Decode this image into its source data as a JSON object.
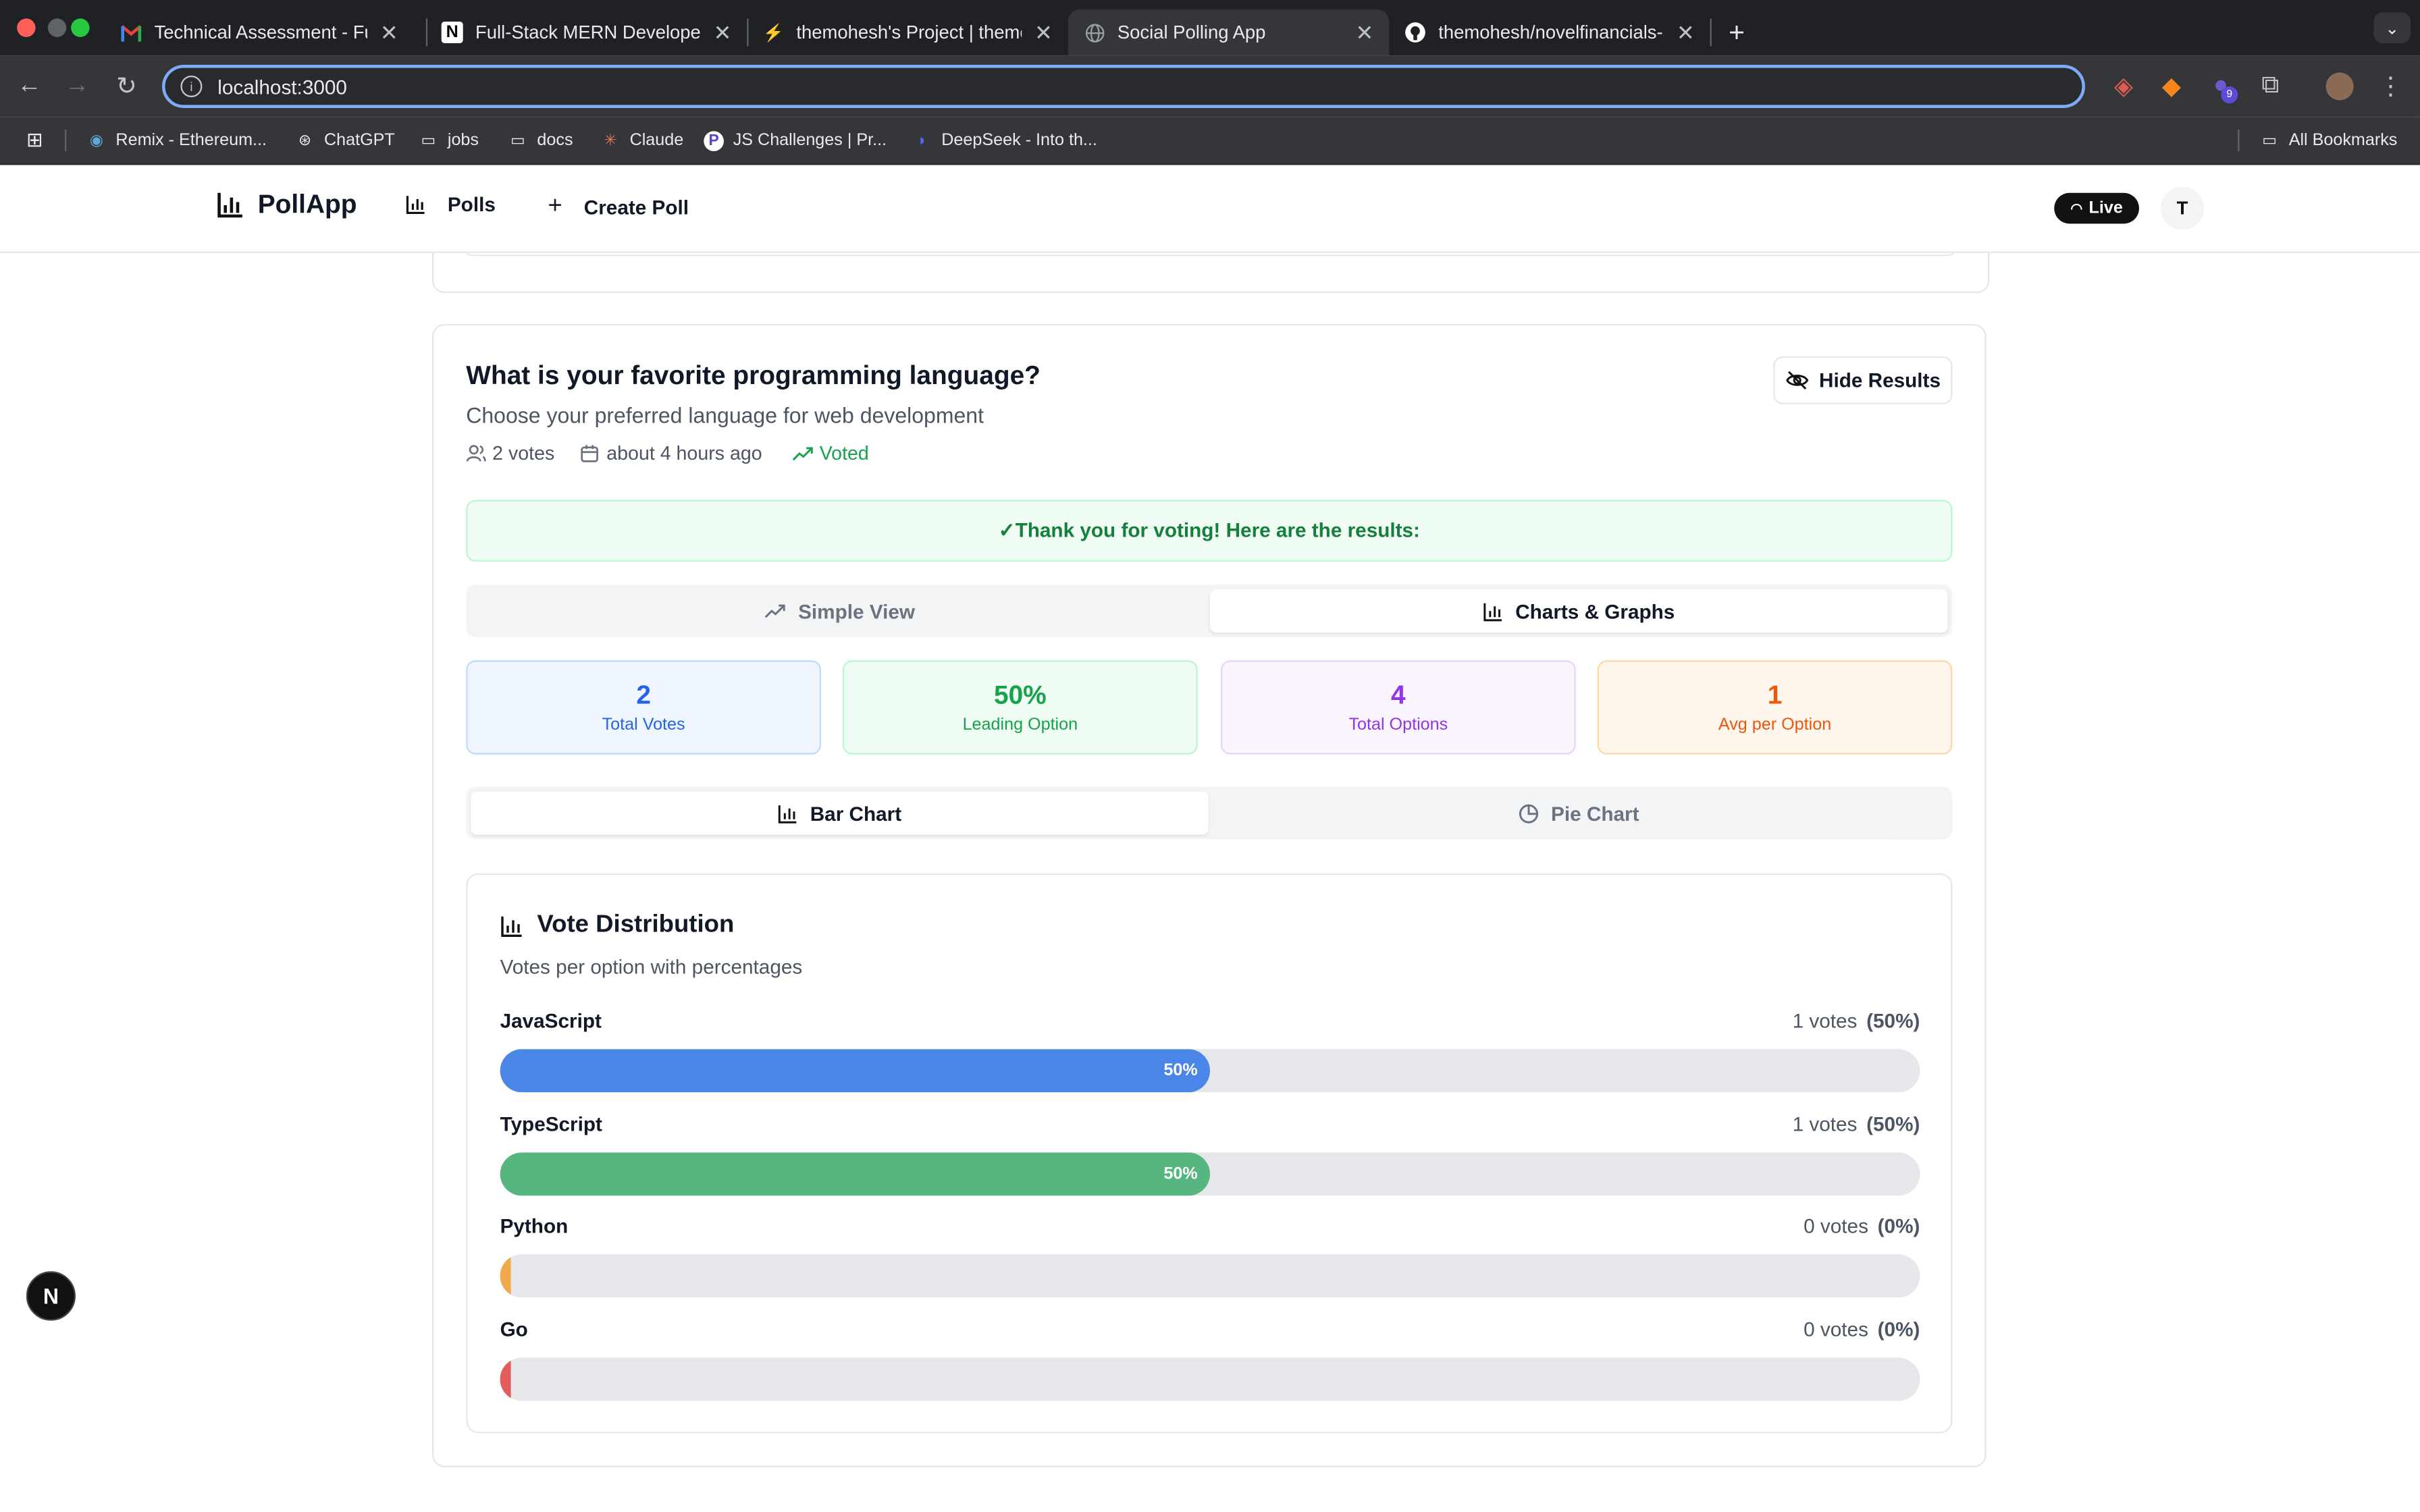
{
  "browser": {
    "tabs": [
      {
        "label": "Technical Assessment - Fullst",
        "icon": "gmail-icon",
        "active": false
      },
      {
        "label": "Full-Stack MERN Developer T",
        "icon": "notion-icon",
        "active": false
      },
      {
        "label": "themohesh's Project | themol",
        "icon": "supabase-icon",
        "active": false
      },
      {
        "label": "Social Polling App",
        "icon": "globe-icon",
        "active": true
      },
      {
        "label": "themohesh/novelfinancials-ar",
        "icon": "github-icon",
        "active": false
      }
    ],
    "url": "localhost:3000",
    "extension_badge": "9",
    "bookmarks": [
      {
        "label": "Remix - Ethereum...",
        "icon": "remix-icon"
      },
      {
        "label": "ChatGPT",
        "icon": "chatgpt-icon"
      },
      {
        "label": "jobs",
        "icon": "folder-icon"
      },
      {
        "label": "docs",
        "icon": "folder-icon"
      },
      {
        "label": "Claude",
        "icon": "claude-icon"
      },
      {
        "label": "JS Challenges | Pr...",
        "icon": "js-challenges-icon"
      },
      {
        "label": "DeepSeek - Into th...",
        "icon": "deepseek-icon"
      }
    ],
    "all_bookmarks": "All Bookmarks"
  },
  "app": {
    "brand": "PollApp",
    "nav": {
      "polls": "Polls",
      "create": "Create Poll"
    },
    "live": "Live",
    "avatar_initial": "T"
  },
  "poll": {
    "title": "What is your favorite programming language?",
    "description": "Choose your preferred language for web development",
    "votes": "2 votes",
    "time": "about 4 hours ago",
    "voted": "Voted",
    "hide_results": "Hide Results",
    "thanks": "✓Thank you for voting! Here are the results:",
    "view_tabs": {
      "simple": "Simple View",
      "charts": "Charts & Graphs",
      "active": "charts"
    },
    "stats": [
      {
        "value": "2",
        "label": "Total Votes",
        "color": "#2563eb",
        "bg": "#eff6ff",
        "border": "#bfdbfe"
      },
      {
        "value": "50%",
        "label": "Leading Option",
        "color": "#16a34a",
        "bg": "#f0fdf4",
        "border": "#bbf7d0"
      },
      {
        "value": "4",
        "label": "Total Options",
        "color": "#9333ea",
        "bg": "#faf5ff",
        "border": "#e9d5ff"
      },
      {
        "value": "1",
        "label": "Avg per Option",
        "color": "#ea580c",
        "bg": "#fff7ed",
        "border": "#fed7aa"
      }
    ],
    "chart_tabs": {
      "bar": "Bar Chart",
      "pie": "Pie Chart",
      "active": "bar"
    },
    "distribution": {
      "title": "Vote Distribution",
      "subtitle": "Votes per option with percentages"
    }
  },
  "chart_data": {
    "type": "bar",
    "title": "Vote Distribution",
    "subtitle": "Votes per option with percentages",
    "categories": [
      "JavaScript",
      "TypeScript",
      "Python",
      "Go"
    ],
    "votes": [
      1,
      1,
      0,
      0
    ],
    "percent": [
      50,
      50,
      0,
      0
    ],
    "vote_labels": [
      "1 votes",
      "1 votes",
      "0 votes",
      "0 votes"
    ],
    "percent_labels": [
      "(50%)",
      "(50%)",
      "(0%)",
      "(0%)"
    ],
    "bar_labels": [
      "50%",
      "50%",
      "",
      ""
    ],
    "colors": [
      "#4a86e8",
      "#57b57f",
      "#f0a94b",
      "#e25c5c"
    ]
  },
  "devtools_badge": "N"
}
